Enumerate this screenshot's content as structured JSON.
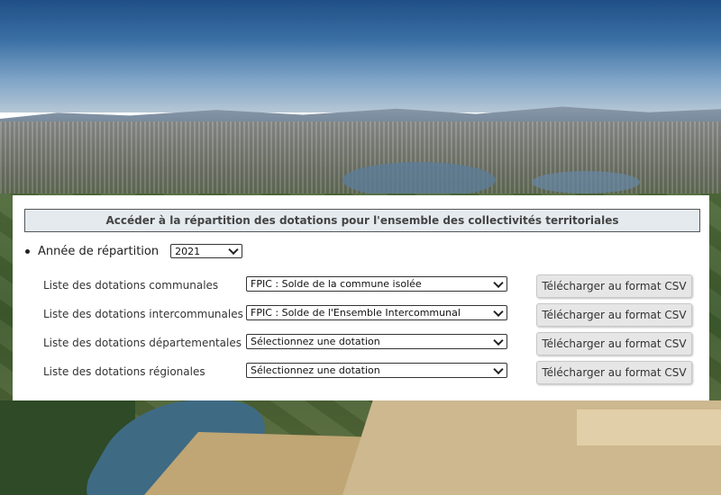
{
  "panel": {
    "title": "Accéder à la répartition des dotations pour l'ensemble des collectivités territoriales"
  },
  "year": {
    "label": "Année de répartition",
    "selected": "2021"
  },
  "rows": [
    {
      "label": "Liste des dotations communales",
      "selected": "FPIC : Solde de la commune isolée",
      "button": "Télécharger au format CSV"
    },
    {
      "label": "Liste des dotations intercommunales",
      "selected": "FPIC : Solde de l'Ensemble Intercommunal",
      "button": "Télécharger au format CSV"
    },
    {
      "label": "Liste des dotations départementales",
      "selected": "Sélectionnez une dotation",
      "button": "Télécharger au format CSV"
    },
    {
      "label": "Liste des dotations régionales",
      "selected": "Sélectionnez une dotation",
      "button": "Télécharger au format CSV"
    }
  ]
}
